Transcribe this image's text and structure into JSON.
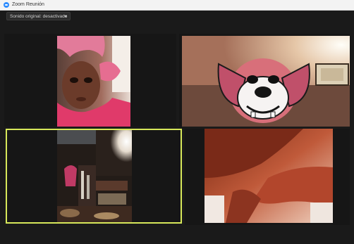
{
  "window": {
    "title": "Zoom Reunión"
  },
  "audio": {
    "label": "Sonido original: desactivado"
  },
  "icons": {
    "app": "zoom-camera-icon",
    "dropdown": "chevron-down-icon"
  },
  "colors": {
    "active_speaker_border": "#d7e85a",
    "background": "#1a1a1a"
  }
}
